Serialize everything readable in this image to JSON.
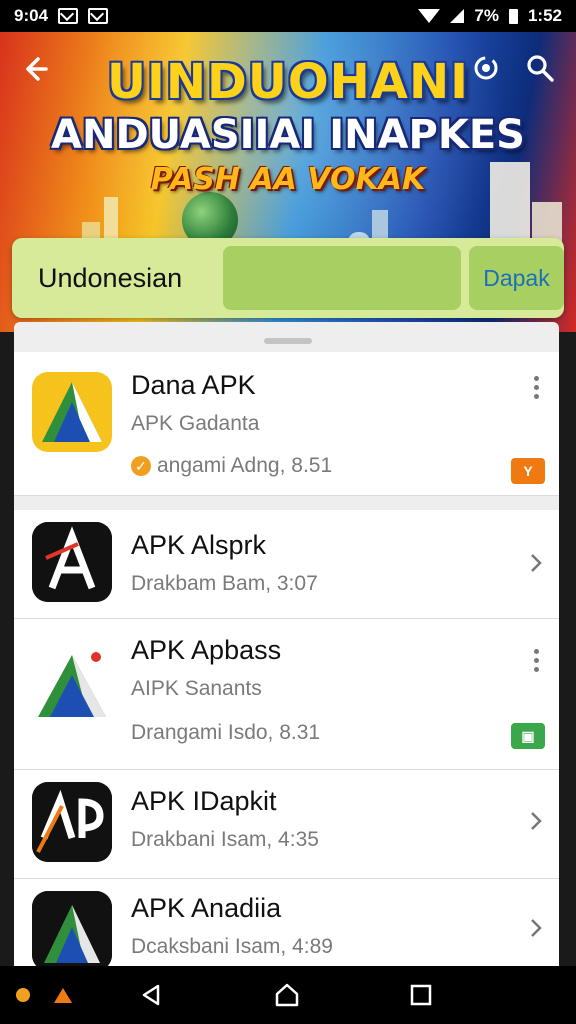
{
  "status_bar": {
    "time": "9:04",
    "battery_percent": "7%",
    "clock_right": "1:52"
  },
  "banner": {
    "title_line1": "UINDUOHANI",
    "title_line2": "ANDUASIIAI INAPKES",
    "title_line3": "PASH AA VOKAK"
  },
  "search": {
    "label": "Undonesian",
    "value": "",
    "button_label": "Dapak"
  },
  "apps": [
    {
      "name": "Dana APK",
      "subtitle": "APK Gadanta",
      "meta": "angami Adng, 8.51",
      "action": "more",
      "badge": "Y",
      "badge_color": "#f07a12"
    },
    {
      "name": "APK Alsprk",
      "subtitle": "",
      "meta": "Drakbam Bam, 3:07",
      "action": "chevron"
    },
    {
      "name": "APK Apbass",
      "subtitle": "AIPK Sanants",
      "meta": "Drangami Isdo, 8.31",
      "action": "more",
      "badge": "▣",
      "badge_color": "#3aa84a"
    },
    {
      "name": "APK IDapkit",
      "subtitle": "",
      "meta": "Drakbani Isam, 4:35",
      "action": "chevron"
    },
    {
      "name": "APK Anadiia",
      "subtitle": "",
      "meta": "Dcaksbani Isam, 4:89",
      "action": "chevron"
    }
  ],
  "icons": {
    "back": "arrow-left-icon",
    "sync": "sync-icon",
    "search": "search-icon",
    "more": "more-vert-icon",
    "chevron": "chevron-right-icon"
  },
  "colors": {
    "search_bg": "#d6ea9a",
    "search_field": "#a8cf62",
    "accent_link": "#1e6fb8"
  }
}
